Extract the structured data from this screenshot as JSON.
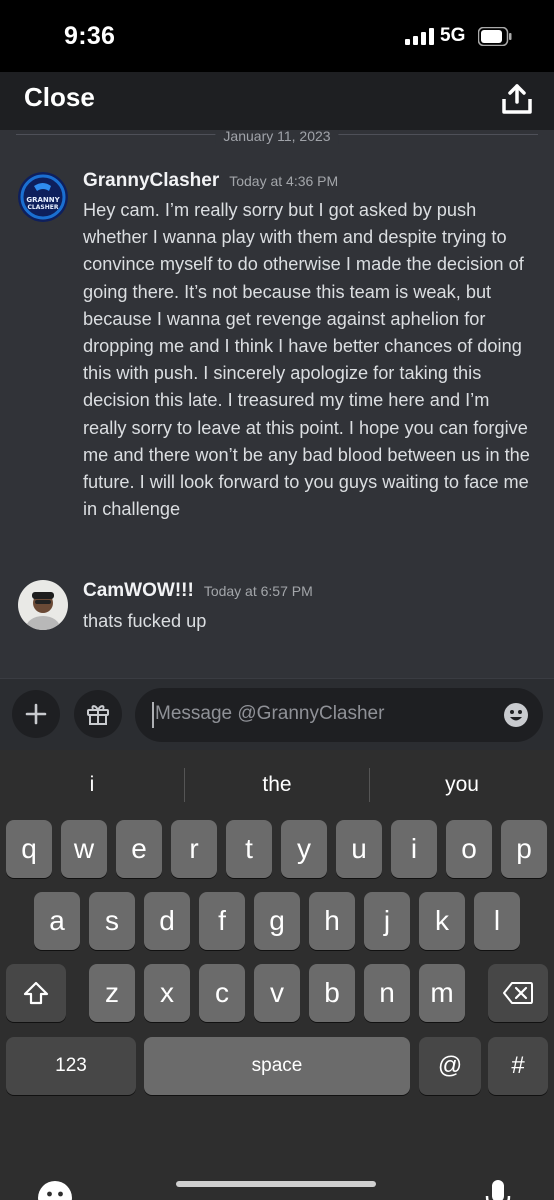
{
  "status_bar": {
    "time": "9:36",
    "network": "5G"
  },
  "top_bar": {
    "close_label": "Close"
  },
  "chat": {
    "date_divider": "January 11, 2023",
    "messages": [
      {
        "author": "GrannyClasher",
        "timestamp": "Today at 4:36 PM",
        "text": "Hey cam. I’m really sorry but I got asked by push whether I wanna play with them and despite trying to convince myself to do otherwise I made the decision of going there. It’s not because this team is weak, but because I wanna get revenge against aphelion for dropping me and I think I have better chances of doing this with push. I sincerely apologize for taking this decision this late. I treasured my time here and I’m really sorry to leave at this point. I hope you can forgive me and there won’t be any bad blood between us in the future. I will look forward to you guys waiting to face me in challenge",
        "avatar_text": "GRANNY CLASHER"
      },
      {
        "author": "CamWOW!!!",
        "timestamp": "Today at 6:57 PM",
        "text": "thats fucked up"
      }
    ]
  },
  "composer": {
    "placeholder": "Message @GrannyClasher"
  },
  "keyboard": {
    "suggestions": [
      "i",
      "the",
      "you"
    ],
    "row1": [
      "q",
      "w",
      "e",
      "r",
      "t",
      "y",
      "u",
      "i",
      "o",
      "p"
    ],
    "row2": [
      "a",
      "s",
      "d",
      "f",
      "g",
      "h",
      "j",
      "k",
      "l"
    ],
    "row3": [
      "z",
      "x",
      "c",
      "v",
      "b",
      "n",
      "m"
    ],
    "numbers_label": "123",
    "space_label": "space",
    "at_label": "@",
    "hash_label": "#"
  },
  "colors": {
    "chat_bg": "#313338",
    "header_bg": "#1e1f22",
    "keyboard_bg": "#2e2e2e",
    "key_bg": "#6b6b6b",
    "brand_blue": "#1a6fd1"
  }
}
